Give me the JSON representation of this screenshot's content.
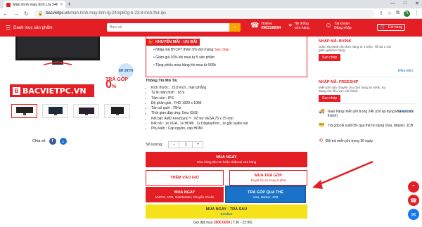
{
  "browser": {
    "tab_title": "Màn hình máy tính LG 24MP60G",
    "tab_close": "×",
    "new_tab": "+",
    "url_domain": "bacvietpc.vn",
    "url_path": "/man-hinh-may-tinh-lg-24mp60g-b-23-8-inch-fhd-ips",
    "avatar_initials": "TL"
  },
  "header": {
    "category_label": "Danh mục sản phẩm",
    "search_placeholder": "Bạn cả",
    "hotline_label": "Hotline",
    "hotline_number": "0963108594",
    "showroom_label": "Hệ thống",
    "showroom_sub": "cửa hàng",
    "account_label": "Tài khoản",
    "account_sub": "Đăng nhập",
    "cart_label": "Giỏ hàng",
    "cart_count": "0"
  },
  "product": {
    "badge_8h": "8H 24TH",
    "tragop_text": "TRẢ GÓP",
    "tragop_zero": "0",
    "tragop_pct": "%",
    "logo_text": "BACVIETPC.VN",
    "share_label": "Chia sẻ"
  },
  "promo": {
    "title": "KHUYẾN MÃI - ƯU ĐÃI",
    "items": [
      {
        "text": "Nhập mã BVCPT thêm 5% đơn hàng ",
        "link": "Sao chép"
      },
      {
        "text": "Giảm giá 10% khi mua từ 5 sản phẩm",
        "link": ""
      },
      {
        "text": "Tặng phiếu mua hàng khi mua từ 500k",
        "link": ""
      }
    ]
  },
  "specs": {
    "title": "Thông Tin Mô Tả:",
    "items": [
      "Kích thước : 23.8 inch , màn phẳng",
      "Tỷ lệ màn hình : 16:9",
      "Tấm nền : IPS",
      "Độ phân giải : FHD 1920 x 1080",
      "Tần số quét : 75Hz",
      "Thời gian đáp ứng: 5ms (GtG)",
      "Nổi bật: AMD FreeSync™ , hỗ trợ VESA 75 x 75 mm",
      "Kết nối : 1x VGA , 1x HDMI , 1x DisplayPort , 1x gắc audio out",
      "Phụ kiện : Cáp nguồn, cáp HDMI"
    ]
  },
  "quantity": {
    "label": "Số lượng:",
    "minus": "-",
    "value": "1",
    "plus": "+"
  },
  "buttons": {
    "buy_now": "MUA NGAY",
    "buy_now_sub": "Giao hàng tận nơi hoặc nhận tại cửa hàng",
    "add_cart": "THÊM VÀO GIỎ",
    "installment": "MUA TRẢ GÓP",
    "installment_sub": "Duyệt hồ sơ trong 5 phút",
    "buy_now2": "MUA NGAY",
    "buy_now2_sub": "VNPAY, ATM, Visa/Master, Chuyển Khoản",
    "card_installment": "TRẢ GÓP QUA THẺ",
    "card_installment_sub": "Visa, Master, JCB",
    "buy_later": "MUA NGAY - TRẢ SAU",
    "buy_later_sub": "Kredivo"
  },
  "call": {
    "text": "Gọi đặt mua ",
    "number": "1800.0000",
    "hours": " (7:30 - 22:00)"
  },
  "vouchers": [
    {
      "title": "NHẬP MÃ: BV99K",
      "desc": "Giảm 99.000đ cho đơn hàng từ 1 triệu. Tối đa 1 mã giảm giá/đơn hàng.",
      "button": "Sao chép",
      "cond": "Điều kiện"
    },
    {
      "title": "NHẬP MÃ: FREESHIP",
      "desc": "Miễn phí vận chuyển cho đơn hàng từ 500k. Áp dụng cho khu vực nội thành.",
      "button": "Sao chép",
      "cond": "Điều kiện"
    }
  ],
  "info": [
    "Giao hàng miễn phí trong 24h (chỉ áp dụng khu vực nội thành)",
    "Trả góp lãi suất 0% qua thẻ tín dụng Visa, Master, JCB",
    "Đổi trả miễn phí trong 30 ngày"
  ],
  "colors": {
    "brand_red": "#e31e24",
    "accent_blue": "#1a73c8",
    "yellow": "#f5e21a",
    "annotation_arrow": "#e31e24"
  }
}
